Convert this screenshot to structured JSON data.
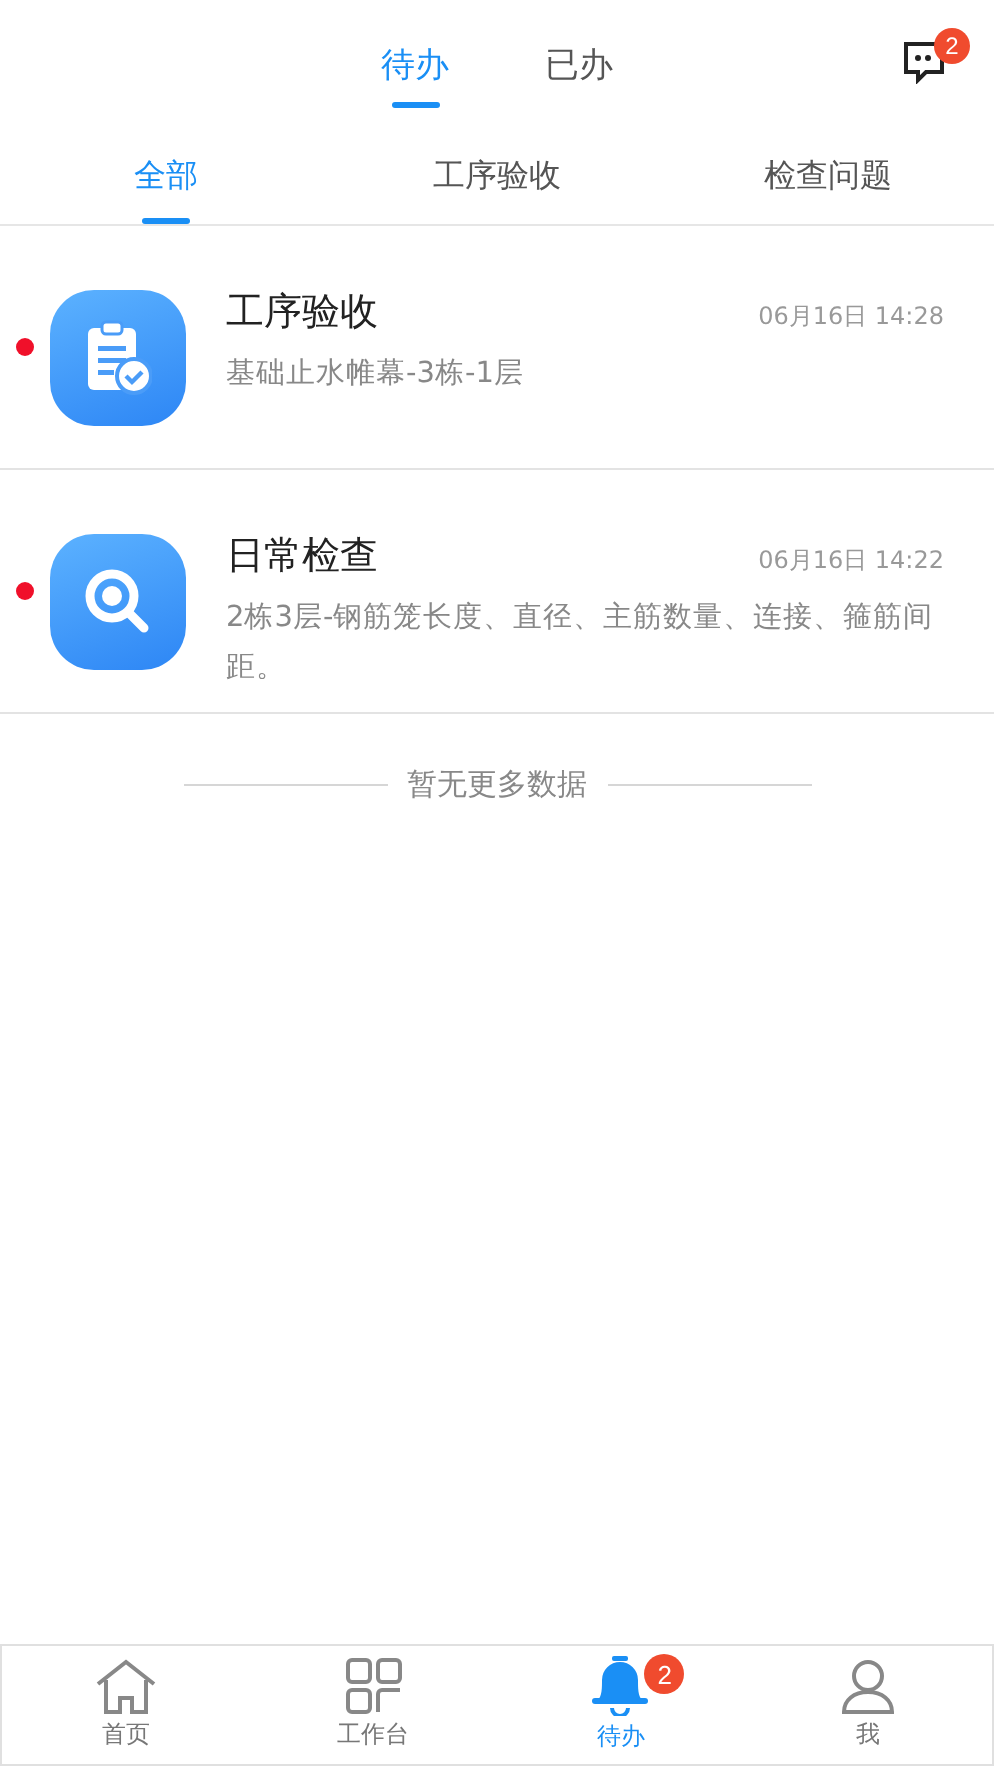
{
  "top_tabs": [
    {
      "label": "待办",
      "selected": true
    },
    {
      "label": "已办",
      "selected": false
    }
  ],
  "message_badge": "2",
  "filter_tabs": [
    {
      "label": "全部",
      "selected": true
    },
    {
      "label": "工序验收",
      "selected": false
    },
    {
      "label": "检查问题",
      "selected": false
    }
  ],
  "items": [
    {
      "kind": "acceptance",
      "unread": true,
      "title": "工序验收",
      "time": "06月16日 14:28",
      "description": "基础止水帷幕-3栋-1层"
    },
    {
      "kind": "inspection",
      "unread": true,
      "title": "日常检查",
      "time": "06月16日 14:22",
      "description": "2栋3层-钢筋笼长度、直径、主筋数量、连接、箍筋间距。"
    }
  ],
  "end_note": "暂无更多数据",
  "bottom_nav": [
    {
      "kind": "home",
      "label": "首页",
      "selected": false
    },
    {
      "kind": "workbench",
      "label": "工作台",
      "selected": false
    },
    {
      "kind": "todo",
      "label": "待办",
      "selected": true,
      "badge": "2"
    },
    {
      "kind": "me",
      "label": "我",
      "selected": false
    }
  ]
}
